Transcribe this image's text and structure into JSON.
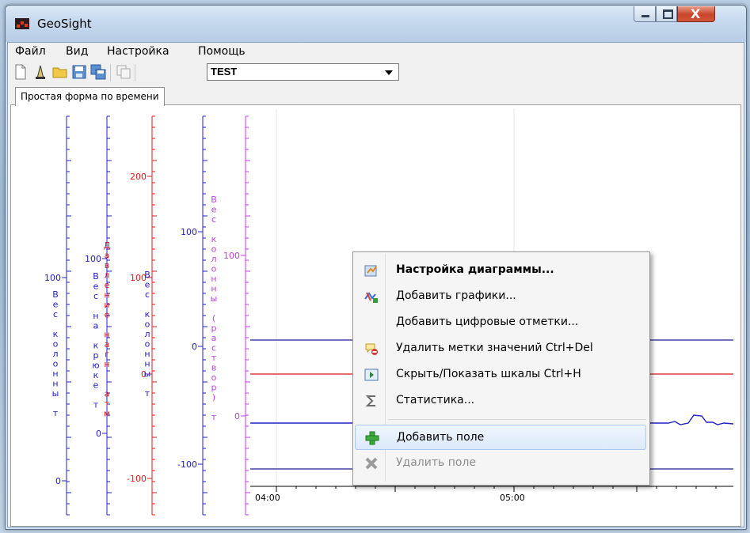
{
  "window": {
    "title": "GeoSight",
    "close_glyph": "X"
  },
  "menu": [
    "Файл",
    "Вид",
    "Настройка",
    "Помощь"
  ],
  "toolbar": {
    "icons": [
      "new-document-icon",
      "rig-icon",
      "open-folder-icon",
      "save-icon",
      "save-all-icon",
      "copy-icon"
    ],
    "combo_value": "TEST"
  },
  "tab": {
    "label": "Простая форма по времени"
  },
  "chart_data": {
    "type": "line",
    "x_ticks": [
      "04:00",
      "05:00"
    ],
    "axes": [
      {
        "label": "Вес колонны т",
        "color": "#2020c8",
        "ticks": [
          "0",
          "100"
        ]
      },
      {
        "label": "Вес на крюке т",
        "color": "#2020c8",
        "ticks": [
          "0",
          "100"
        ]
      },
      {
        "label": "Давление нагн. атм",
        "color": "#e01818",
        "ticks": [
          "-100",
          "0",
          "100",
          "200"
        ]
      },
      {
        "label": "Вес колонны т",
        "color": "#2020c8",
        "ticks": [
          "-100",
          "0",
          "100"
        ]
      },
      {
        "label": "Вес колонны (раствор) т",
        "color": "#c040e0",
        "ticks": [
          "0",
          "100"
        ]
      }
    ]
  },
  "context_menu": {
    "items": [
      {
        "label": "Настройка диаграммы...",
        "icon": "chart-settings-icon",
        "bold": true
      },
      {
        "label": "Добавить графики...",
        "icon": "add-graphs-icon"
      },
      {
        "label": "Добавить цифровые отметки...",
        "icon": ""
      },
      {
        "label": "Удалить метки значений Ctrl+Del",
        "icon": "remove-labels-icon"
      },
      {
        "label": "Скрыть/Показать шкалы  Ctrl+H",
        "icon": "toggle-scales-icon"
      },
      {
        "label": "Статистика...",
        "icon": "sigma-icon"
      },
      {
        "label": "Добавить поле",
        "icon": "plus-icon",
        "highlighted": true
      },
      {
        "label": "Удалить поле",
        "icon": "delete-x-icon",
        "disabled": true
      }
    ]
  },
  "colors": {
    "blue": "#2020c8",
    "red": "#e01818",
    "purple": "#c040e0",
    "line_blue": "#1c1c96",
    "line_red": "#d81818"
  }
}
